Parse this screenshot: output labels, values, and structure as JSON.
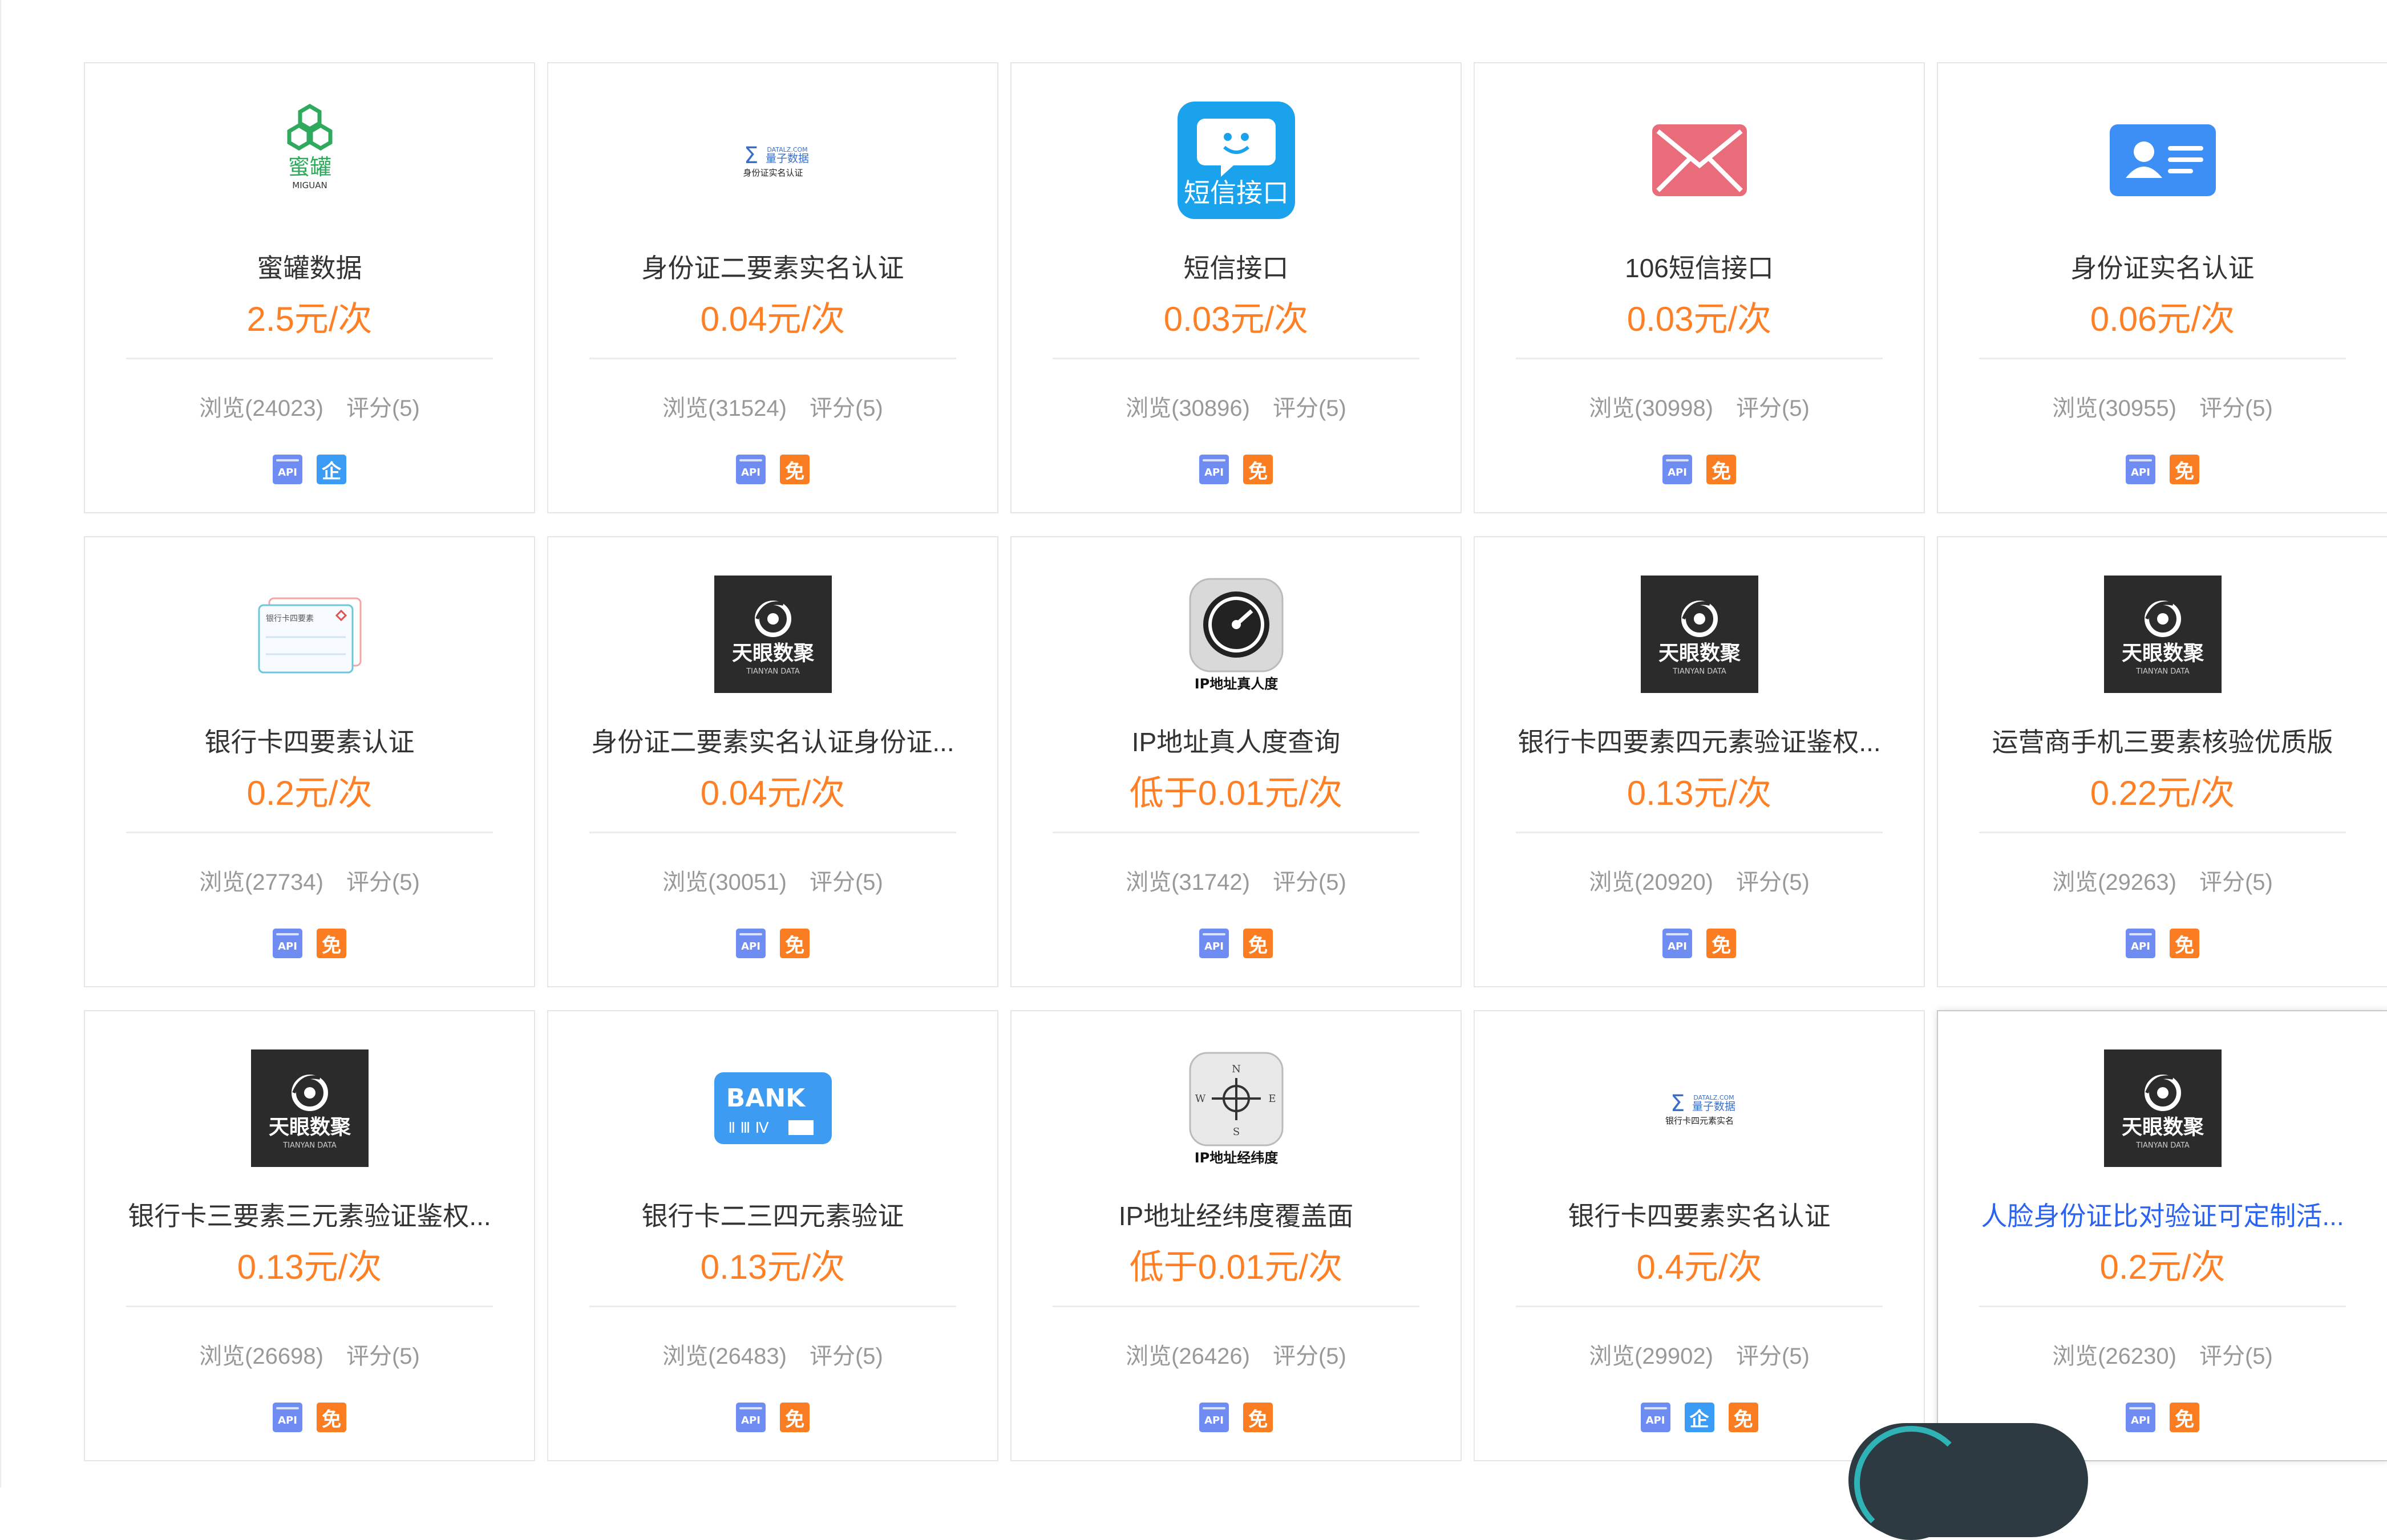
{
  "stats_labels": {
    "views_prefix": "浏览",
    "rating_prefix": "评分"
  },
  "badge_labels": {
    "api": "API",
    "enterprise": "企",
    "free": "免"
  },
  "colors": {
    "price": "#ff7f24",
    "api_badge": "#6f8cf3",
    "enterprise_badge": "#3a9cf4",
    "free_badge": "#fb7d22",
    "hover_title": "#2a63f0"
  },
  "products": [
    {
      "name": "蜜罐数据",
      "price": "2.5元/次",
      "views": "浏览(24023)",
      "rating": "评分(5)",
      "logo": "miguan-logo",
      "logo_text": [
        "蜜罐",
        "MIGUAN"
      ],
      "badges": [
        "api",
        "enterprise"
      ]
    },
    {
      "name": "身份证二要素实名认证",
      "price": "0.04元/次",
      "views": "浏览(31524)",
      "rating": "评分(5)",
      "logo": "liangzi-logo",
      "logo_text": [
        "DATALZ.COM",
        "量子数据",
        "身份证实名认证"
      ],
      "badges": [
        "api",
        "free"
      ]
    },
    {
      "name": "短信接口",
      "price": "0.03元/次",
      "views": "浏览(30896)",
      "rating": "评分(5)",
      "logo": "sms-chat-icon",
      "logo_text": [
        "短信接口"
      ],
      "badges": [
        "api",
        "free"
      ]
    },
    {
      "name": "106短信接口",
      "price": "0.03元/次",
      "views": "浏览(30998)",
      "rating": "评分(5)",
      "logo": "envelope-icon",
      "logo_text": [],
      "badges": [
        "api",
        "free"
      ]
    },
    {
      "name": "身份证实名认证",
      "price": "0.06元/次",
      "views": "浏览(30955)",
      "rating": "评分(5)",
      "logo": "id-card-icon",
      "logo_text": [],
      "badges": [
        "api",
        "free"
      ]
    },
    {
      "name": "银行卡四要素认证",
      "price": "0.2元/次",
      "views": "浏览(27734)",
      "rating": "评分(5)",
      "logo": "bank-card-form-icon",
      "logo_text": [
        "银行卡四要素"
      ],
      "badges": [
        "api",
        "free"
      ]
    },
    {
      "name": "身份证二要素实名认证身份证...",
      "price": "0.04元/次",
      "views": "浏览(30051)",
      "rating": "评分(5)",
      "logo": "tianyan-logo",
      "logo_text": [
        "天眼数聚",
        "TIANYAN DATA"
      ],
      "badges": [
        "api",
        "free"
      ]
    },
    {
      "name": "IP地址真人度查询",
      "price": "低于0.01元/次",
      "views": "浏览(31742)",
      "rating": "评分(5)",
      "logo": "gauge-icon",
      "logo_text": [
        "IP地址真人度"
      ],
      "badges": [
        "api",
        "free"
      ]
    },
    {
      "name": "银行卡四要素四元素验证鉴权...",
      "price": "0.13元/次",
      "views": "浏览(20920)",
      "rating": "评分(5)",
      "logo": "tianyan-logo",
      "logo_text": [
        "天眼数聚",
        "TIANYAN DATA"
      ],
      "badges": [
        "api",
        "free"
      ]
    },
    {
      "name": "运营商手机三要素核验优质版",
      "price": "0.22元/次",
      "views": "浏览(29263)",
      "rating": "评分(5)",
      "logo": "tianyan-logo",
      "logo_text": [
        "天眼数聚",
        "TIANYAN DATA"
      ],
      "badges": [
        "api",
        "free"
      ]
    },
    {
      "name": "银行卡三要素三元素验证鉴权...",
      "price": "0.13元/次",
      "views": "浏览(26698)",
      "rating": "评分(5)",
      "logo": "tianyan-logo",
      "logo_text": [
        "天眼数聚",
        "TIANYAN DATA"
      ],
      "badges": [
        "api",
        "free"
      ]
    },
    {
      "name": "银行卡二三四元素验证",
      "price": "0.13元/次",
      "views": "浏览(26483)",
      "rating": "评分(5)",
      "logo": "bank-logo",
      "logo_text": [
        "BANK",
        "Ⅱ Ⅲ Ⅳ"
      ],
      "badges": [
        "api",
        "free"
      ]
    },
    {
      "name": "IP地址经纬度覆盖面",
      "price": "低于0.01元/次",
      "views": "浏览(26426)",
      "rating": "评分(5)",
      "logo": "compass-icon",
      "logo_text": [
        "N",
        "W",
        "E",
        "S",
        "IP地址经纬度"
      ],
      "badges": [
        "api",
        "free"
      ]
    },
    {
      "name": "银行卡四要素实名认证",
      "price": "0.4元/次",
      "views": "浏览(29902)",
      "rating": "评分(5)",
      "logo": "liangzi-logo",
      "logo_text": [
        "DATALZ.COM",
        "量子数据",
        "银行卡四元素实名"
      ],
      "badges": [
        "api",
        "enterprise",
        "free"
      ]
    },
    {
      "name": "人脸身份证比对验证可定制活...",
      "price": "0.2元/次",
      "views": "浏览(26230)",
      "rating": "评分(5)",
      "logo": "tianyan-logo",
      "logo_text": [
        "天眼数聚",
        "TIANYAN DATA"
      ],
      "badges": [
        "api",
        "free"
      ],
      "hover": true
    }
  ]
}
